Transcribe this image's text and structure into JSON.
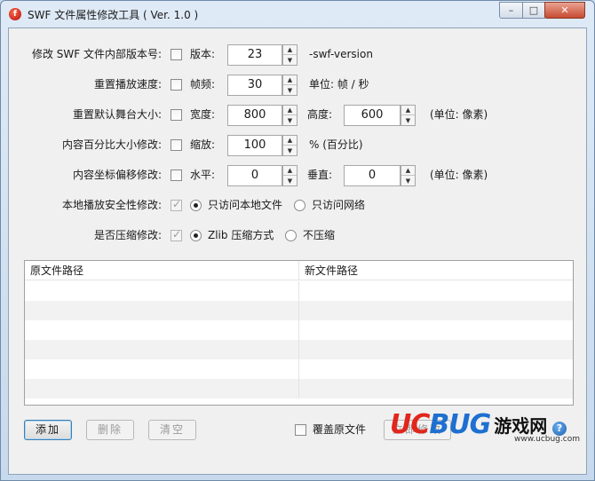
{
  "window": {
    "title": "SWF 文件属性修改工具 ( Ver. 1.0 )",
    "minimize": "–",
    "maximize": "□",
    "close": "✕"
  },
  "settings": {
    "version": {
      "label": "修改 SWF 文件内部版本号:",
      "checkbox": "版本:",
      "value": "23",
      "unit": "-swf-version"
    },
    "framerate": {
      "label": "重置播放速度:",
      "checkbox": "帧频:",
      "value": "30",
      "unit": "单位: 帧 / 秒"
    },
    "stage": {
      "label": "重置默认舞台大小:",
      "checkbox": "宽度:",
      "width": "800",
      "height_label": "高度:",
      "height": "600",
      "unit": "(单位: 像素)"
    },
    "scale": {
      "label": "内容百分比大小修改:",
      "checkbox": "缩放:",
      "value": "100",
      "unit": "% (百分比)"
    },
    "offset": {
      "label": "内容坐标偏移修改:",
      "checkbox": "水平:",
      "x": "0",
      "y_label": "垂直:",
      "y": "0",
      "unit": "(单位: 像素)"
    },
    "security": {
      "label": "本地播放安全性修改:",
      "option_local": "只访问本地文件",
      "option_network": "只访问网络",
      "selected": "option_local"
    },
    "compress": {
      "label": "是否压缩修改:",
      "option_zlib": "Zlib 压缩方式",
      "option_none": "不压缩",
      "selected": "option_zlib"
    }
  },
  "table": {
    "columns": [
      "原文件路径",
      "新文件路径"
    ],
    "rows": []
  },
  "footer": {
    "add": "添加",
    "delete": "删除",
    "clear": "清空",
    "overwrite": "覆盖原文件",
    "apply": "立即修改",
    "help": "?"
  },
  "watermark": {
    "brand_uc": "UC",
    "brand_bug": "BUG",
    "brand_cn": "游戏网",
    "url": "www.ucbug.com"
  },
  "colors": {
    "accent_red": "#e1261c",
    "accent_blue": "#1e6fd0",
    "window_frame": "#c7d9ec"
  }
}
